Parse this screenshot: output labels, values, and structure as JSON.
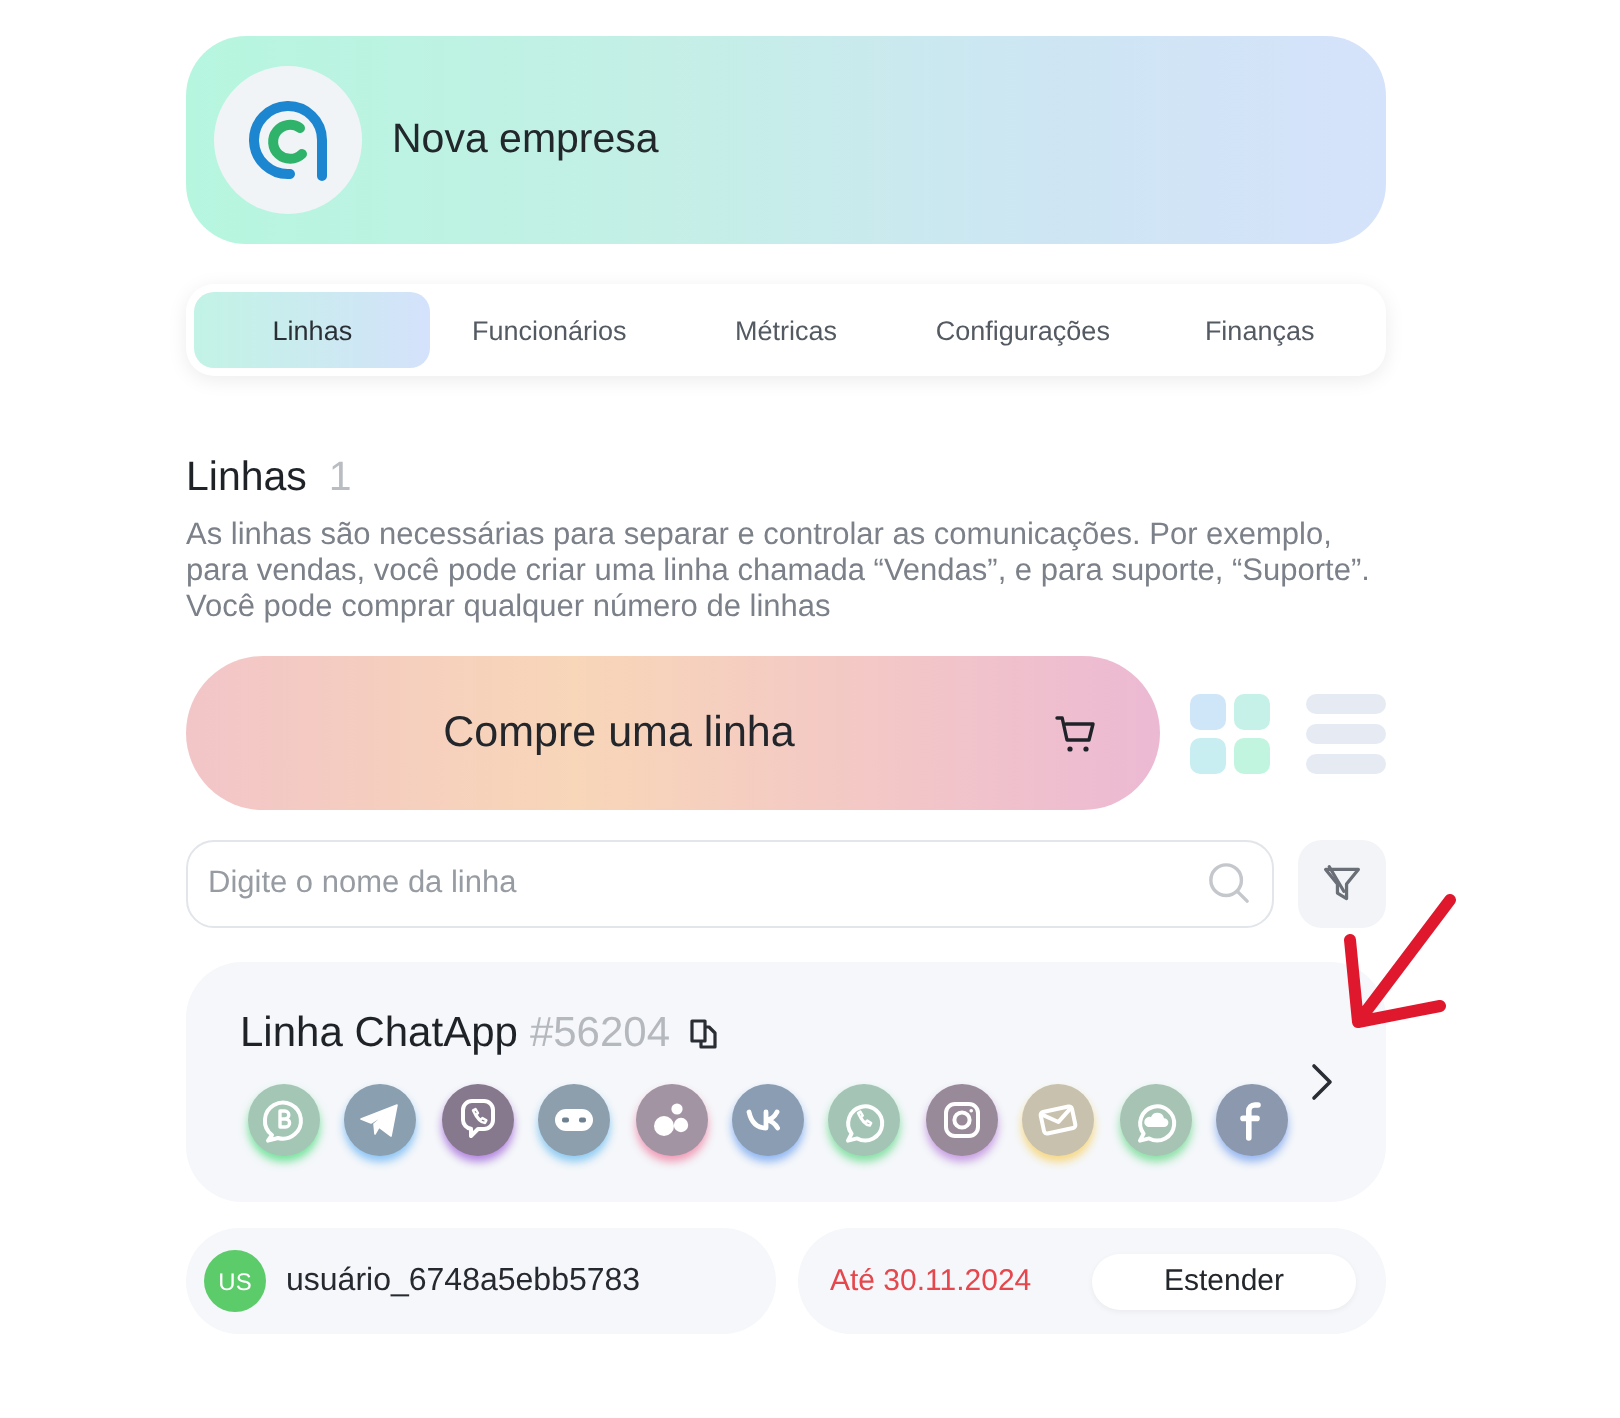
{
  "company": {
    "name": "Nova empresa"
  },
  "tabs": [
    {
      "label": "Linhas",
      "selected": true
    },
    {
      "label": "Funcionários",
      "selected": false
    },
    {
      "label": "Métricas",
      "selected": false
    },
    {
      "label": "Configurações",
      "selected": false
    },
    {
      "label": "Finanças",
      "selected": false
    }
  ],
  "section": {
    "title": "Linhas",
    "count": "1",
    "description": "As linhas são necessárias para separar e controlar as comunicações. Por exemplo, para vendas, você pode criar uma linha chamada “Vendas”, e para suporte, “Suporte”. Você pode comprar qualquer número de linhas"
  },
  "buy_button": {
    "label": "Compre uma linha"
  },
  "view_toggles": [
    {
      "kind": "grid",
      "selected": true
    },
    {
      "kind": "list",
      "selected": false
    }
  ],
  "search": {
    "placeholder": "Digite o nome da linha"
  },
  "lines": [
    {
      "name": "Linha ChatApp",
      "number": "#56204",
      "channels": [
        {
          "kind": "business"
        },
        {
          "kind": "plane"
        },
        {
          "kind": "phonebubble"
        },
        {
          "kind": "bot"
        },
        {
          "kind": "dots"
        },
        {
          "kind": "vk"
        },
        {
          "kind": "chat"
        },
        {
          "kind": "camera"
        },
        {
          "kind": "mail"
        },
        {
          "kind": "cloud"
        },
        {
          "kind": "letterf"
        }
      ],
      "owner": {
        "initials": "US",
        "name": "usuário_6748a5ebb5783"
      },
      "expiry": "Até 30.11.2024",
      "extend_button": "Estender"
    }
  ],
  "annotations": [
    {
      "kind": "arrow"
    }
  ]
}
